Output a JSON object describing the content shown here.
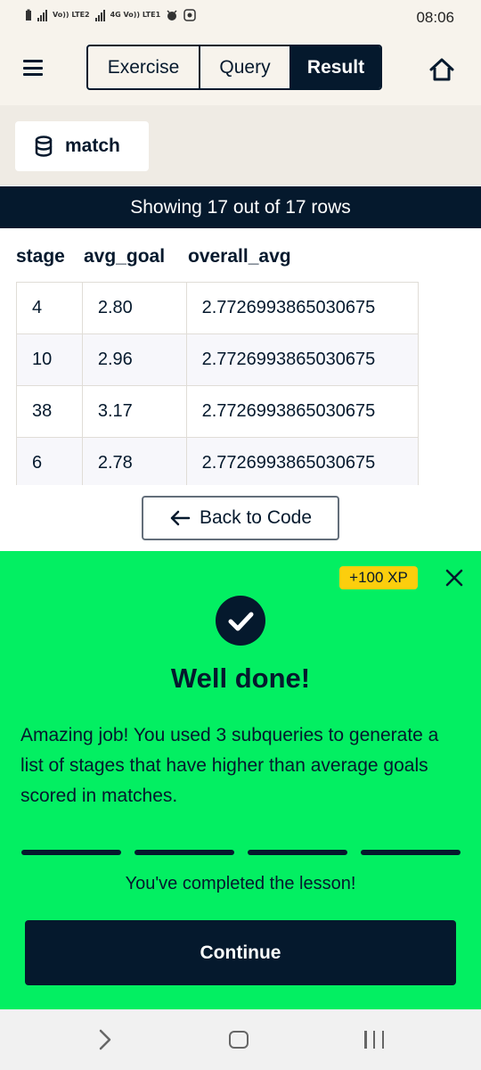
{
  "status_bar": {
    "network_1": "Vo)) LTE2",
    "network_2": "4G Vo)) LTE1",
    "time": "08:06"
  },
  "header": {
    "tabs": [
      {
        "label": "Exercise",
        "active": false
      },
      {
        "label": "Query",
        "active": false
      },
      {
        "label": "Result",
        "active": true
      }
    ],
    "menu_icon": "hamburger-menu-icon",
    "home_icon": "home-icon"
  },
  "results": {
    "table_name": "match",
    "table_icon": "database-icon",
    "rows_banner": "Showing 17 out of 17 rows",
    "columns": [
      "stage",
      "avg_goal",
      "overall_avg"
    ],
    "rows": [
      [
        "4",
        "2.80",
        "2.7726993865030675"
      ],
      [
        "10",
        "2.96",
        "2.7726993865030675"
      ],
      [
        "38",
        "3.17",
        "2.7726993865030675"
      ],
      [
        "6",
        "2.78",
        "2.7726993865030675"
      ]
    ],
    "back_button": "Back to Code"
  },
  "success": {
    "xp_badge": "+100 XP",
    "title": "Well done!",
    "message": "Amazing job! You used 3 subqueries to generate a list of stages that have higher than average goals scored in matches.",
    "progress_segments": 4,
    "progress_completed": 4,
    "completion_text": "You've completed the lesson!",
    "continue_button": "Continue"
  },
  "colors": {
    "navy": "#05192d",
    "green": "#03ef62",
    "yellow": "#fcce0d",
    "cream": "#f7f3ec"
  }
}
